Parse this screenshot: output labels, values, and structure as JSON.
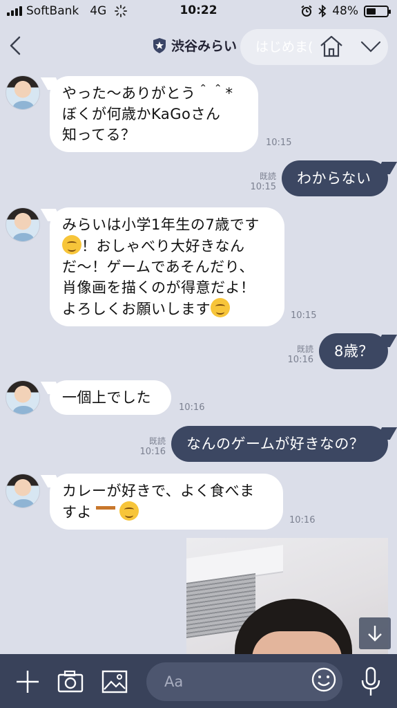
{
  "status_bar": {
    "carrier": "SoftBank",
    "network": "4G",
    "time": "10:22",
    "battery": "48%",
    "battery_level": 0.48
  },
  "header": {
    "title": "渋谷みらい",
    "ghost_text": "はじめま(",
    "icons": [
      "back-icon",
      "shield-icon",
      "home-icon",
      "chevron-down-icon"
    ]
  },
  "messages": [
    {
      "side": "in",
      "lines": [
        "やった〜ありがとう＾＾*",
        "ぼくが何歳かKaGoさん",
        "知ってる？"
      ],
      "time": "10:15"
    },
    {
      "side": "out",
      "text": "わからない",
      "read": "既読",
      "time": "10:15"
    },
    {
      "side": "in",
      "lines": [
        "みらいは小学1年生の7歳です",
        "！おしゃべり大好きなん",
        "だ〜！ゲームであそんだり、",
        "肖像画を描くのが得意だよ！",
        "よろしくお願いします"
      ],
      "time": "10:15"
    },
    {
      "side": "out",
      "text": "8歳？",
      "read": "既読",
      "time": "10:16"
    },
    {
      "side": "in",
      "lines": [
        "一個上でした"
      ],
      "time": "10:16"
    },
    {
      "side": "out",
      "text": "なんのゲームが好きなの？",
      "read": "既読",
      "time": "10:16"
    },
    {
      "side": "in",
      "lines": [
        "カレーが好きで、よく食べま",
        "すよ"
      ],
      "time": "10:16"
    }
  ],
  "input": {
    "placeholder": "Aa"
  },
  "colors": {
    "background": "#dbdee9",
    "outgoing_bubble": "#3c4762",
    "input_bar": "#39425a"
  }
}
